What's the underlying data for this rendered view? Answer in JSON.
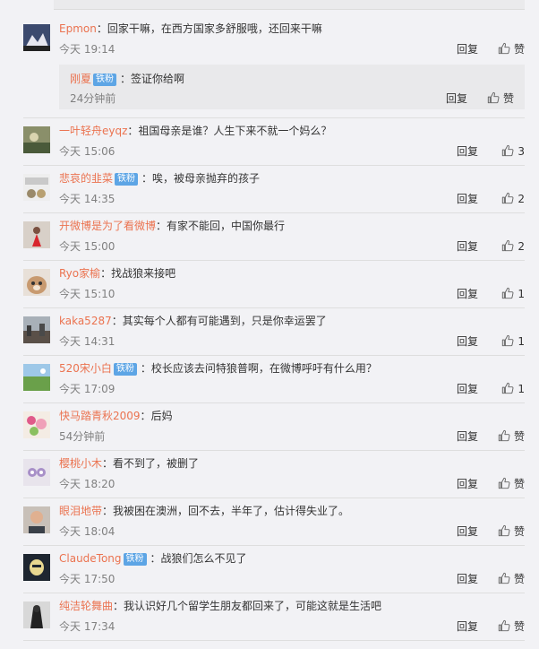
{
  "ui": {
    "reply_label": "回复",
    "like_label": "赞",
    "like_icon": "thumbs-up-icon"
  },
  "comments": [
    {
      "user": "Epmon",
      "badge": "",
      "sep": "：",
      "text": "回家干嘛，在西方国家多舒服哦，还回来干嘛",
      "time": "今天 19:14",
      "likes": "赞",
      "sub": {
        "user": "刚夏",
        "badge": "铁粉",
        "sep": "：",
        "text": "签证你给啊",
        "time": "24分钟前",
        "likes": "赞"
      }
    },
    {
      "user": "一叶轻舟eyqz",
      "badge": "",
      "sep": "：",
      "text": "祖国母亲是谁？人生下来不就一个妈么？",
      "time": "今天 15:06",
      "likes": "3"
    },
    {
      "user": "悲哀的韭菜",
      "badge": "铁粉",
      "sep": "：",
      "text": "唉，被母亲抛弃的孩子",
      "time": "今天 14:35",
      "likes": "2"
    },
    {
      "user": "开微博是为了看微博",
      "badge": "",
      "sep": "：",
      "text": "有家不能回，中国你最行",
      "time": "今天 15:00",
      "likes": "2"
    },
    {
      "user": "Ryo家榆",
      "badge": "",
      "sep": "：",
      "text": "找战狼来接吧",
      "time": "今天 15:10",
      "likes": "1"
    },
    {
      "user": "kaka5287",
      "badge": "",
      "sep": "：",
      "text": "其实每个人都有可能遇到，只是你幸运罢了",
      "time": "今天 14:31",
      "likes": "1"
    },
    {
      "user": "520宋小白",
      "badge": "铁粉",
      "sep": "：",
      "text": "校长应该去问特狼普啊，在微博呼吁有什么用？",
      "time": "今天 17:09",
      "likes": "1"
    },
    {
      "user": "快马踏青秋2009",
      "badge": "",
      "sep": "：",
      "text": "后妈",
      "time": "54分钟前",
      "likes": "赞"
    },
    {
      "user": "樱桃小木",
      "badge": "",
      "sep": "：",
      "text": "看不到了，被删了",
      "time": "今天 18:20",
      "likes": "赞"
    },
    {
      "user": "眼泪地带",
      "badge": "",
      "sep": "：",
      "text": "我被困在澳洲，回不去，半年了，估计得失业了。",
      "time": "今天 18:04",
      "likes": "赞"
    },
    {
      "user": "ClaudeTong",
      "badge": "铁粉",
      "sep": "：",
      "text": "战狼们怎么不见了",
      "time": "今天 17:50",
      "likes": "赞"
    },
    {
      "user": "纯洁轮舞曲",
      "badge": "",
      "sep": "：",
      "text": "我认识好几个留学生朋友都回来了，可能这就是生活吧",
      "time": "今天 17:34",
      "likes": "赞"
    }
  ]
}
